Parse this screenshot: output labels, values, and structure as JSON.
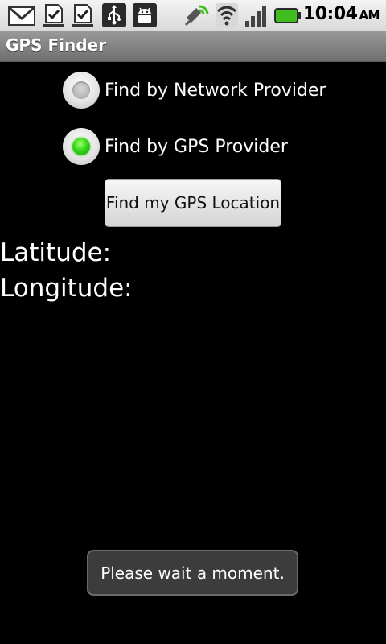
{
  "status_bar": {
    "time": "10:04",
    "ampm": "AM",
    "icons": [
      "gmail-icon",
      "task-done-icon",
      "task-done-icon",
      "usb-icon",
      "android-debug-icon",
      "gps-satellite-icon",
      "wifi-icon",
      "signal-icon",
      "battery-icon"
    ],
    "battery_color": "#3fbf1f"
  },
  "app": {
    "title": "GPS Finder"
  },
  "options": {
    "network": {
      "label": "Find by Network Provider",
      "checked": false
    },
    "gps": {
      "label": "Find by GPS Provider",
      "checked": true
    }
  },
  "button": {
    "label": "Find my GPS Location"
  },
  "results": {
    "latitude_label": "Latitude:",
    "longitude_label": "Longitude:"
  },
  "toast": {
    "message": "Please wait a moment."
  }
}
